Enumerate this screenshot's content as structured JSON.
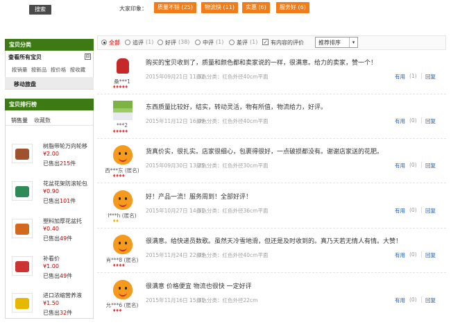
{
  "search": {
    "button_label": "搜索"
  },
  "sidebar": {
    "category_title": "宝贝分类",
    "category_all": "查看所有宝贝",
    "category_toggle": "⊟",
    "category_subs": [
      "按销量",
      "按新品",
      "按价格",
      "按收藏"
    ],
    "category_mobile": "移动旅盘",
    "ranking_title": "宝贝排行榜",
    "ranking_tabs": [
      "销售量",
      "收藏数"
    ],
    "products": [
      {
        "name": "树脂带轮万向轮移",
        "price": "¥2.00",
        "sold_prefix": "已售出",
        "sold": "215",
        "sold_suffix": "件",
        "color": "#a0522d"
      },
      {
        "name": "花盆花架防滚轮包",
        "price": "¥0.90",
        "sold_prefix": "已售出",
        "sold": "101",
        "sold_suffix": "件",
        "color": "#2e8b57"
      },
      {
        "name": "塑料加厚花盆托",
        "price": "¥0.40",
        "sold_prefix": "已售出",
        "sold": "49",
        "sold_suffix": "件",
        "color": "#d2691e"
      },
      {
        "name": "补看价",
        "price": "¥1.00",
        "sold_prefix": "已售出",
        "sold": "49",
        "sold_suffix": "件",
        "color": "#cc3333"
      },
      {
        "name": "进口浓缩营养液",
        "price": "¥1.50",
        "sold_prefix": "已售出",
        "sold": "32",
        "sold_suffix": "件",
        "color": "#e6b800"
      }
    ]
  },
  "impressions": {
    "label": "大家印象：",
    "tags": [
      "质量不错 (25)",
      "物流快 (11)",
      "实惠 (6)",
      "服务好 (6)"
    ]
  },
  "filter": {
    "options": [
      {
        "label": "全部",
        "count": ""
      },
      {
        "label": "追评",
        "count": "(1)"
      },
      {
        "label": "好评",
        "count": "(38)"
      },
      {
        "label": "中评",
        "count": "(1)"
      },
      {
        "label": "差评",
        "count": "(1)"
      }
    ],
    "with_content_label": "有内容的评价",
    "with_content_check": "✓",
    "sort_label": "推荐排序",
    "sort_caret": "▾"
  },
  "reviews": [
    {
      "user": "桑***1",
      "rank": "♦♦♦♦♦",
      "avatar": "robot",
      "text": "购买的宝贝收到了，质量和颜色都和卖家说的一样，很满意。给力的卖家，赞一个！",
      "date": "2015年09月21日 11:52",
      "spec": "颜色分类：红色外径40cm平面",
      "useful": "有用",
      "useful_count": "(1)",
      "reply": "回复"
    },
    {
      "user": "***2",
      "rank": "♦♦♦♦♦",
      "avatar": "landscape",
      "text": "东西质量比较好，结实，转动灵活，物有所值，物流给力，好评。",
      "date": "2015年11月12日 16:09",
      "spec": "颜色分类：红色外径40cm平面",
      "useful": "有用",
      "useful_count": "(0)",
      "reply": "回复"
    },
    {
      "user": "西***东 (匿名)",
      "rank": "♦♦♦♦",
      "avatar": "orange",
      "text": "货真价实，很扎实。店家很细心，包裹得很好，一点破损都没有。谢谢店家送的花肥。",
      "date": "2015年09月30日 13:25",
      "spec": "颜色分类：红色外径30cm平面",
      "useful": "有用",
      "useful_count": "(0)",
      "reply": "回复"
    },
    {
      "user": "l***h (匿名)",
      "rank": "♦♦",
      "rank_gold": true,
      "avatar": "orange",
      "text": "好！产品一流！服务周到！全部好评！",
      "date": "2015年10月27日 14:51",
      "spec": "颜色分类：红色外径36cm平面",
      "useful": "有用",
      "useful_count": "(0)",
      "reply": "回复"
    },
    {
      "user": "肖***8 (匿名)",
      "rank": "♦♦♦♦",
      "avatar": "orange",
      "text": "很满意。给快递员数歌。虽然天冷雪地滑，但还是及时收到的。真乃天若无情人有情。大赞！",
      "date": "2015年11月24日 22:03",
      "spec": "颜色分类：红色外径40cm平面",
      "useful": "有用",
      "useful_count": "(0)",
      "reply": "回复"
    },
    {
      "user": "允***6 (匿名)",
      "rank": "♦♦♦",
      "avatar": "orange",
      "text": "很满意 价格便宜 物流也很快 一定好评",
      "date": "2015年11月16日 15:31",
      "spec": "颜色分类：红色外径22cm",
      "useful": "有用",
      "useful_count": "(0)",
      "reply": "回复"
    }
  ]
}
